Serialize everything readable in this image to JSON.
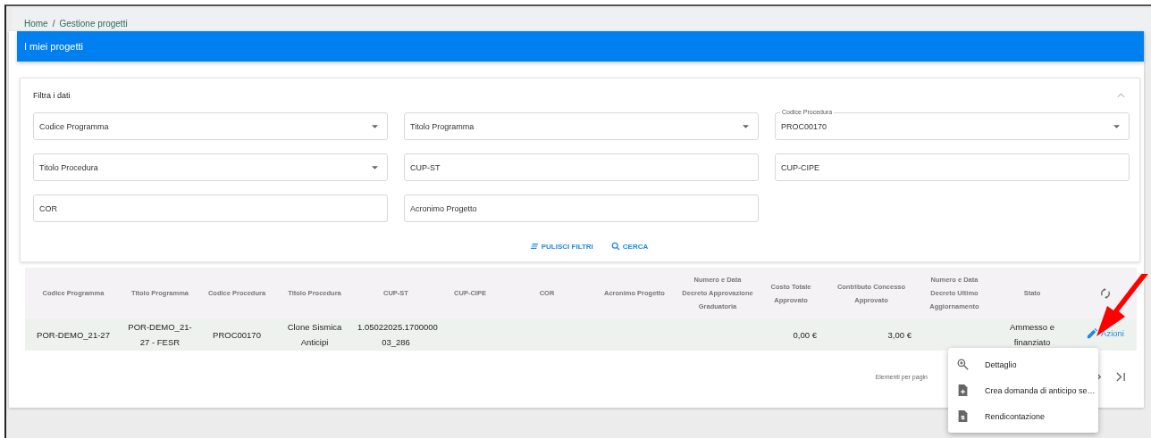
{
  "breadcrumb": [
    {
      "label": "Home"
    },
    {
      "label": "Gestione progetti"
    }
  ],
  "breadcrumb_separator": "/",
  "page_title": "I miei progetti",
  "filter": {
    "title": "Filtra i dati",
    "expanded": true,
    "fields": [
      {
        "kind": "select",
        "placeholder": "Codice Programma"
      },
      {
        "kind": "select",
        "placeholder": "Titolo Programma"
      },
      {
        "kind": "select",
        "label": "Codice Procedura",
        "value": "PROC00170"
      },
      {
        "kind": "select",
        "placeholder": "Titolo Procedura"
      },
      {
        "kind": "text",
        "placeholder": "CUP-ST"
      },
      {
        "kind": "text",
        "placeholder": "CUP-CIPE"
      },
      {
        "kind": "text",
        "placeholder": "COR"
      },
      {
        "kind": "text",
        "placeholder": "Acronimo Progetto"
      }
    ],
    "buttons": [
      {
        "kind": "clear",
        "label": "PULISCI FILTRI"
      },
      {
        "kind": "search",
        "label": "CERCA"
      }
    ]
  },
  "table": {
    "columns": [
      "Codice Programma",
      "Titolo Programma",
      "Codice Procedura",
      "Titolo Procedura",
      "CUP-ST",
      "CUP-CIPE",
      "COR",
      "Acronimo Progetto",
      "Numero e Data Decreto Approvazione Graduatoria",
      "Costo Totale Approvato",
      "Contributo Concesso Approvato",
      "Numero e Data Decreto Ultimo Aggiornamento",
      "Stato"
    ],
    "rows": [
      {
        "cells": [
          "POR-DEMO_21-27",
          "POR-DEMO_21-27 - FESR",
          "PROC00170",
          "Clone Sismica Anticipi",
          "1.05022025.1700000 03_286",
          "",
          "",
          "",
          "",
          "0,00 €",
          "3,00 €",
          "",
          "Ammesso e finanziato"
        ],
        "action": "Azioni"
      }
    ]
  },
  "pagination": {
    "label": "Elementi per pagin"
  },
  "menu": [
    {
      "kind": "zoom",
      "label": "Dettaglio"
    },
    {
      "kind": "add",
      "label": "Crea domanda di anticipo se…"
    },
    {
      "kind": "money",
      "label": "Rendicontazione"
    }
  ]
}
